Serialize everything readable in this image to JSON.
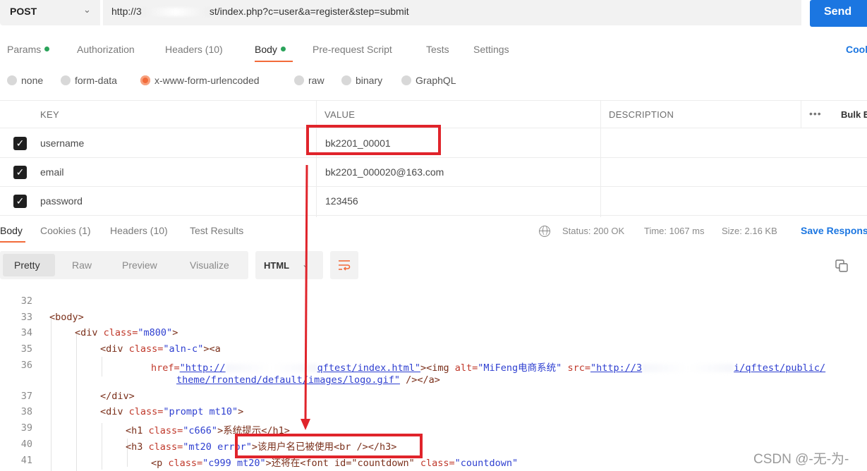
{
  "request": {
    "method": "POST",
    "url_prefix": "http://3",
    "url_suffix": "st/index.php?c=user&a=register&step=submit",
    "send_label": "Send"
  },
  "request_tabs": {
    "params": "Params",
    "authorization": "Authorization",
    "headers": "Headers (10)",
    "body": "Body",
    "pre_request": "Pre-request Script",
    "tests": "Tests",
    "settings": "Settings",
    "cookies": "Cookies"
  },
  "body_types": {
    "none": "none",
    "form_data": "form-data",
    "urlencoded": "x-www-form-urlencoded",
    "raw": "raw",
    "binary": "binary",
    "graphql": "GraphQL",
    "selected": "x-www-form-urlencoded"
  },
  "params_table": {
    "headers": {
      "key": "KEY",
      "value": "VALUE",
      "description": "DESCRIPTION",
      "more": "•••",
      "bulk": "Bulk Edit"
    },
    "rows": [
      {
        "checked": true,
        "key": "username",
        "value": "bk2201_00001"
      },
      {
        "checked": true,
        "key": "email",
        "value": "bk2201_000020@163.com"
      },
      {
        "checked": true,
        "key": "password",
        "value": "123456"
      }
    ]
  },
  "response_tabs": {
    "body": "Body",
    "cookies": "Cookies (1)",
    "headers": "Headers (10)",
    "test_results": "Test Results",
    "status": "Status: 200 OK",
    "time": "Time: 1067 ms",
    "size": "Size: 2.16 KB",
    "save": "Save Response"
  },
  "format_bar": {
    "pretty": "Pretty",
    "raw": "Raw",
    "preview": "Preview",
    "visualize": "Visualize",
    "language": "HTML"
  },
  "code": {
    "ln32": "32",
    "ln33": "33",
    "ln34": "34",
    "ln35": "35",
    "ln36": "36",
    "ln37": "37",
    "ln38": "38",
    "ln39": "39",
    "ln40": "40",
    "ln41": "41",
    "body_tag": "<body>",
    "div_open": "<div ",
    "class_attr": "class=",
    "m800": "\"m800\"",
    "aln": "\"aln-c\"",
    "a_open": "><a",
    "href_attr": "href=",
    "href_val_a": "\"http://",
    "href_val_b": "qftest/index.html\"",
    "img_part": "><img ",
    "alt_attr": "alt=",
    "alt_val": "\"MiFeng电商系统\"",
    "src_attr": " src=",
    "src_val_a": "\"http://3",
    "src_val_b": "i/qftest/public/",
    "line36b": "theme/frontend/default/images/logo.gif\"",
    "line36b_end": " /></a>",
    "div_close": "</div>",
    "prompt": "\"prompt mt10\"",
    "h1_open": "<h1 ",
    "c666": "\"c666\"",
    "h1_text": ">系统提示</h1>",
    "h3_open": "<h3 ",
    "mt20": "\"mt20 error\"",
    "h3_text": ">该用户名已被使用<br /></h3>",
    "p_open": "<p ",
    "c999": "\"c999 mt20\"",
    "p_text": ">还将在<font id=\"countdown\" ",
    "countdown": "\"countdown\"",
    "gt": ">"
  },
  "watermark": "CSDN @-无-为-",
  "colors": {
    "accent": "#f26b3a",
    "send": "#1b76e1",
    "annotation": "#e0242b",
    "ok": "#2aa35a"
  }
}
